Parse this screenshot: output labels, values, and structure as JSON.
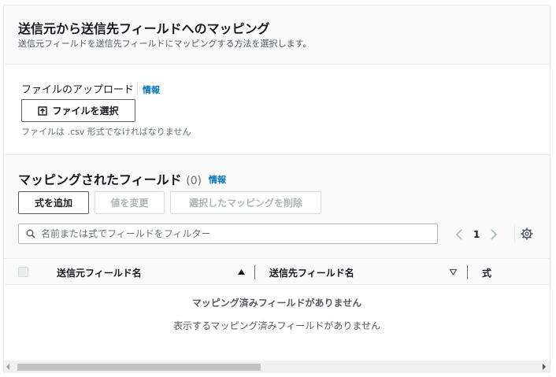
{
  "header": {
    "title": "送信元から送信先フィールドへのマッピング",
    "subtitle": "送信元フィールドを送信先フィールドにマッピングする方法を選択します。"
  },
  "upload": {
    "label": "ファイルのアップロード",
    "info": "情報",
    "button_label": "ファイルを選択",
    "hint": "ファイルは .csv 形式でなければなりません"
  },
  "mapped": {
    "title": "マッピングされたフィールド",
    "count": "(0)",
    "info": "情報",
    "actions": {
      "add_formula": "式を追加",
      "change_value": "値を変更",
      "delete_selected": "選択したマッピングを削除"
    },
    "search": {
      "placeholder": "名前または式でフィールドをフィルター",
      "value": ""
    },
    "pagination": {
      "current_page": "1"
    },
    "table": {
      "columns": [
        "送信元フィールド名",
        "送信先フィールド名",
        "式"
      ],
      "empty_title": "マッピング済みフィールドがありません",
      "empty_description": "表示するマッピング済みフィールドがありません"
    }
  },
  "colors": {
    "link": "#0073bb",
    "text": "#16191f",
    "muted": "#545b64",
    "border": "#eaeded",
    "section_bg": "#fafafa"
  },
  "icons": {
    "upload": "upload-icon",
    "search": "search-icon",
    "prev": "chevron-left-icon",
    "next": "chevron-right-icon",
    "settings": "gear-icon",
    "sort_asc": "caret-up-icon",
    "sort_desc": "caret-down-icon"
  }
}
